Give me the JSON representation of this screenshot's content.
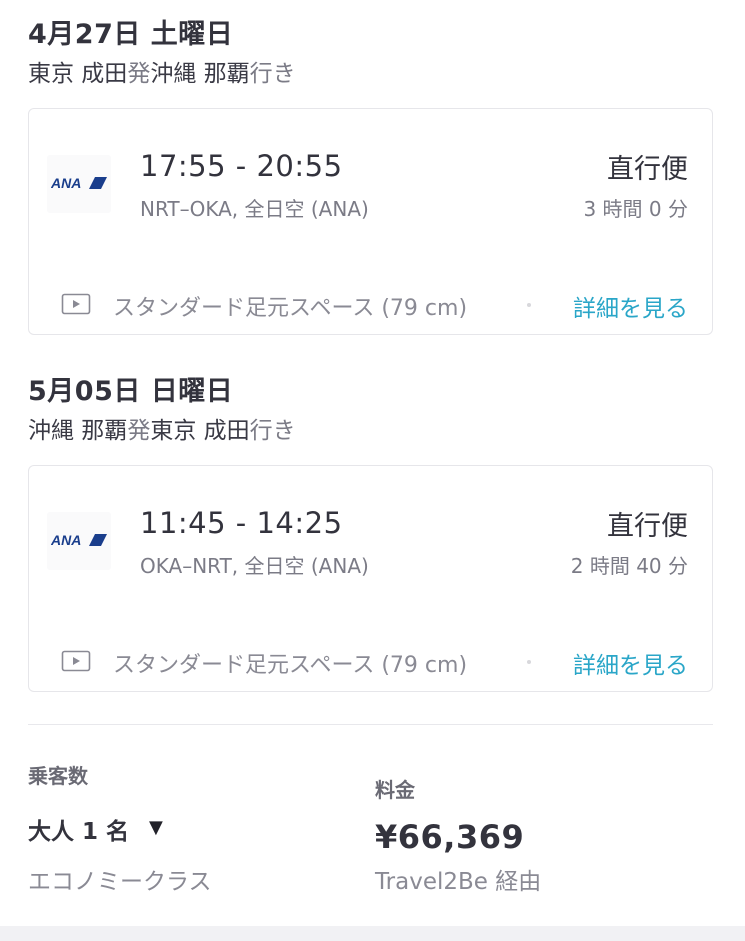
{
  "outbound": {
    "date": "4月27日 土曜日",
    "route": {
      "from": "東京 成田",
      "from_suffix": "発",
      "to": "沖縄 那覇",
      "to_suffix": "行き"
    },
    "flight": {
      "airline_logo": "ANA",
      "times": "17:55 - 20:55",
      "sub": "NRT–OKA, 全日空 (ANA)",
      "stops": "直行便",
      "duration": "3 時間 0 分",
      "amenity": "スタンダード足元スペース (79 cm)",
      "details_label": "詳細を見る"
    }
  },
  "return": {
    "date": "5月05日 日曜日",
    "route": {
      "from": "沖縄 那覇",
      "from_suffix": "発",
      "to": "東京 成田",
      "to_suffix": "行き"
    },
    "flight": {
      "airline_logo": "ANA",
      "times": "11:45 - 14:25",
      "sub": "OKA–NRT, 全日空 (ANA)",
      "stops": "直行便",
      "duration": "2 時間 40 分",
      "amenity": "スタンダード足元スペース (79 cm)",
      "details_label": "詳細を見る"
    }
  },
  "summary": {
    "passengers_label": "乗客数",
    "passengers_value": "大人 1 名",
    "caret": "▼",
    "cabin": "エコノミークラス",
    "price_label": "料金",
    "price": "¥66,369",
    "via": "Travel2Be 経由"
  },
  "colors": {
    "accent": "#2aa6c8",
    "ana_blue": "#1a3e8c"
  },
  "icons": {
    "amenity": "video-screen-icon",
    "dropdown": "caret-down-icon"
  }
}
